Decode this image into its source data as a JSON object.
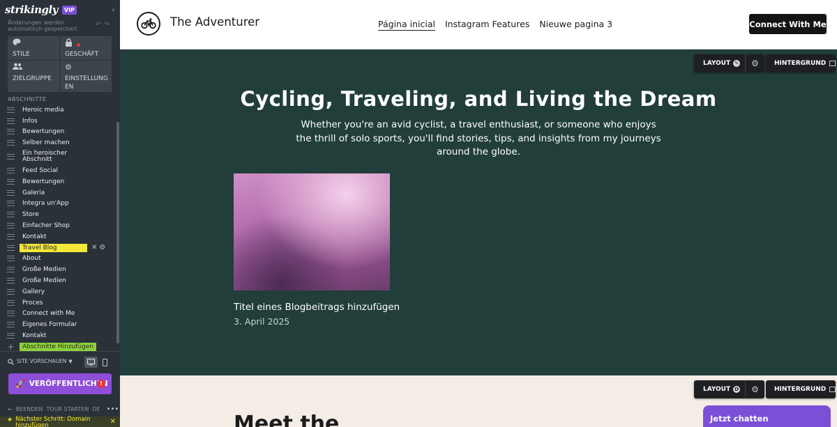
{
  "editor": {
    "logo": "strikingly",
    "badge": "VIP",
    "autosave_text": "Änderungen werden automatisch gespeichert.",
    "tiles": [
      {
        "icon": "palette-icon",
        "label": "STILE"
      },
      {
        "icon": "lock-icon",
        "label": "GESCHÄFT"
      },
      {
        "icon": "users-icon",
        "label": "ZIELGRUPPE"
      },
      {
        "icon": "gear-icon",
        "label": "EINSTELLUNG EN"
      }
    ],
    "sections_heading": "ABSCHNITTE",
    "sections": [
      {
        "label": "Heroic media"
      },
      {
        "label": "Infos"
      },
      {
        "label": "Bewertungen"
      },
      {
        "label": "Selber machen"
      },
      {
        "label": "Ein heroischer Abschnitt"
      },
      {
        "label": "Feed Social"
      },
      {
        "label": "Bewertungen"
      },
      {
        "label": "Galeria"
      },
      {
        "label": "Integra un'App"
      },
      {
        "label": "Store"
      },
      {
        "label": "Einfacher Shop"
      },
      {
        "label": "Kontakt"
      },
      {
        "label": "Travel Blog",
        "active": true
      },
      {
        "label": "About"
      },
      {
        "label": "Große Medien"
      },
      {
        "label": "Große Medien"
      },
      {
        "label": "Gallery"
      },
      {
        "label": "Proces"
      },
      {
        "label": "Connect with Me"
      },
      {
        "label": "Eigenes Formular"
      },
      {
        "label": "Kontakt"
      }
    ],
    "add_section_label": "Abschnitte Hinzufügen",
    "preview_label": "SITE VORSCHAUEN",
    "publish_label": "VERÖFFENTLICHEN",
    "publish_alert": "!",
    "bottom_links": [
      "BEENDEN",
      "TOUR STARTEN",
      "DE"
    ],
    "next_step": "Nächster Schritt: Domain hinzufügen"
  },
  "site": {
    "brand": "The Adventurer",
    "nav": [
      "Página inicial",
      "Instagram Features",
      "Nieuwe pagina 3"
    ],
    "cta": "Connect With Me",
    "controls": {
      "layout": "LAYOUT",
      "background": "HINTERGRUND"
    },
    "hero": {
      "title": "Cycling, Traveling, and Living the Dream",
      "subtitle": "Whether you're an avid cyclist, a travel enthusiast, or someone who enjoys the thrill of solo sports, you'll find stories, tips, and insights from my journeys around the globe.",
      "post_title": "Titel eines Blogbeitrags hinzufügen",
      "post_date": "3. April 2025"
    },
    "next_section_heading": "Meet the",
    "chat_label": "Jetzt chatten"
  }
}
